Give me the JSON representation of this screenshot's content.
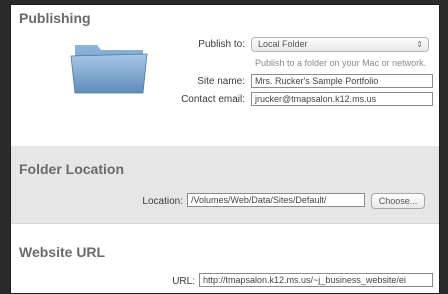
{
  "publishing": {
    "title": "Publishing",
    "publish_to_label": "Publish to:",
    "publish_to_value": "Local Folder",
    "publish_hint": "Publish to a folder on your Mac or network.",
    "site_name_label": "Site name:",
    "site_name_value": "Mrs. Rucker's Sample Portfolio",
    "contact_email_label": "Contact email:",
    "contact_email_value": "jrucker@tmapsalon.k12.ms.us"
  },
  "folder_location": {
    "title": "Folder Location",
    "location_label": "Location:",
    "location_value": "/Volumes/Web/Data/Sites/Default/",
    "choose_label": "Choose..."
  },
  "website_url": {
    "title": "Website URL",
    "url_label": "URL:",
    "url_value": "http://tmapsalon.k12.ms.us/~j_business_website/ei"
  },
  "colors": {
    "section_title": "#6a6a6a",
    "band": "#e6e6e6",
    "folder_blue": "#7fa6cf"
  }
}
